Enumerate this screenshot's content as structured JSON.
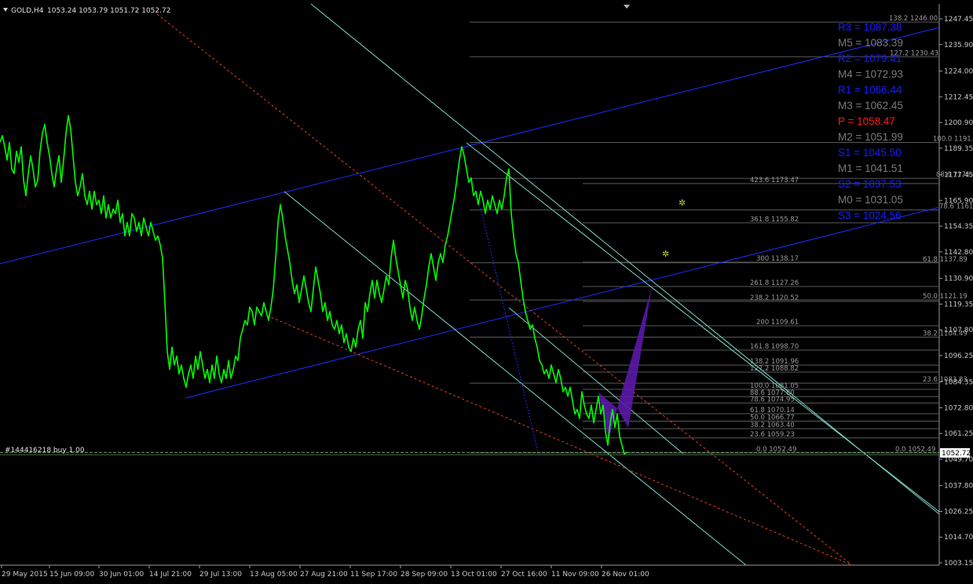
{
  "header": {
    "menu_icon": "triangle-down-icon",
    "symbol": "GOLD,H4",
    "ohlc": "1053.24 1053.79 1051.72 1052.72"
  },
  "colors": {
    "background": "#000000",
    "price": "#00ff00",
    "channel": "#1e2cff",
    "trendline": "#7fd6c8",
    "dashed": "#e0401e",
    "fib": "#5a5a5a",
    "pattern": "#5a1aa8",
    "pivot_r": "#1a1aff",
    "pivot_m": "#7a7a7a",
    "pivot_p": "#ff1a1a",
    "pivot_s": "#1a1aff",
    "current_price_bg": "#ffffff"
  },
  "pivots": [
    {
      "label": "R3 = 1087.38",
      "kind": "r"
    },
    {
      "label": "M5 = 1083.39",
      "kind": "m"
    },
    {
      "label": "R2 = 1079.41",
      "kind": "r"
    },
    {
      "label": "M4 = 1072.93",
      "kind": "m"
    },
    {
      "label": "R1 = 1066.44",
      "kind": "r"
    },
    {
      "label": "M3 = 1062.45",
      "kind": "m"
    },
    {
      "label": "P  = 1058.47",
      "kind": "p"
    },
    {
      "label": "M2 = 1051.99",
      "kind": "m"
    },
    {
      "label": "S1 = 1045.50",
      "kind": "s"
    },
    {
      "label": "M1 = 1041.51",
      "kind": "m"
    },
    {
      "label": "S2 = 1037.53",
      "kind": "s"
    },
    {
      "label": "M0 = 1031.05",
      "kind": "m"
    },
    {
      "label": "S3 = 1024.56",
      "kind": "s"
    }
  ],
  "order_label": "#144416218 buy 1.00",
  "current_price": "1052.72",
  "chart_data": {
    "type": "line",
    "symbol": "GOLD",
    "timeframe": "H4",
    "ylim": [
      1003.15,
      1247.45
    ],
    "y_ticks": [
      "1247.45",
      "1235.90",
      "1224.00",
      "1212.45",
      "1200.90",
      "1189.35",
      "1177.45",
      "1165.90",
      "1154.35",
      "1142.80",
      "1130.90",
      "1119.35",
      "1107.80",
      "1096.25",
      "1084.35",
      "1072.80",
      "1061.25",
      "1049.70",
      "1037.80",
      "1026.25",
      "1014.70",
      "1003.15"
    ],
    "x_ticks": [
      "29 May 2015",
      "15 Jun 09:00",
      "30 Jun 01:00",
      "14 Jul 21:00",
      "29 Jul 13:00",
      "13 Aug 05:00",
      "27 Aug 21:00",
      "11 Sep 17:00",
      "28 Sep 09:00",
      "13 Oct 01:00",
      "27 Oct 16:00",
      "11 Nov 09:00",
      "26 Nov 01:00"
    ],
    "series": [
      {
        "values": [
          [
            0,
            1192
          ],
          [
            3,
            1195
          ],
          [
            6,
            1190
          ],
          [
            9,
            1184
          ],
          [
            12,
            1192
          ],
          [
            15,
            1180
          ],
          [
            18,
            1178
          ],
          [
            21,
            1188
          ],
          [
            24,
            1183
          ],
          [
            27,
            1190
          ],
          [
            30,
            1175
          ],
          [
            33,
            1168
          ],
          [
            36,
            1178
          ],
          [
            39,
            1186
          ],
          [
            42,
            1180
          ],
          [
            45,
            1172
          ],
          [
            48,
            1175
          ],
          [
            51,
            1188
          ],
          [
            54,
            1196
          ],
          [
            57,
            1200
          ],
          [
            60,
            1192
          ],
          [
            63,
            1186
          ],
          [
            66,
            1178
          ],
          [
            69,
            1172
          ],
          [
            72,
            1180
          ],
          [
            75,
            1186
          ],
          [
            78,
            1174
          ],
          [
            81,
            1184
          ],
          [
            84,
            1196
          ],
          [
            87,
            1204
          ],
          [
            90,
            1198
          ],
          [
            93,
            1186
          ],
          [
            96,
            1174
          ],
          [
            99,
            1168
          ],
          [
            102,
            1172
          ],
          [
            105,
            1178
          ],
          [
            108,
            1168
          ],
          [
            111,
            1164
          ],
          [
            114,
            1170
          ],
          [
            117,
            1162
          ],
          [
            120,
            1170
          ],
          [
            123,
            1164
          ],
          [
            126,
            1166
          ],
          [
            129,
            1160
          ],
          [
            132,
            1168
          ],
          [
            135,
            1158
          ],
          [
            138,
            1164
          ],
          [
            141,
            1158
          ],
          [
            144,
            1162
          ],
          [
            147,
            1160
          ],
          [
            150,
            1166
          ],
          [
            153,
            1156
          ],
          [
            156,
            1160
          ],
          [
            159,
            1150
          ],
          [
            162,
            1156
          ],
          [
            165,
            1150
          ],
          [
            168,
            1160
          ],
          [
            171,
            1158
          ],
          [
            174,
            1152
          ],
          [
            177,
            1156
          ],
          [
            180,
            1150
          ],
          [
            183,
            1158
          ],
          [
            186,
            1154
          ],
          [
            189,
            1150
          ],
          [
            192,
            1156
          ],
          [
            195,
            1152
          ],
          [
            198,
            1148
          ],
          [
            201,
            1150
          ],
          [
            204,
            1146
          ],
          [
            207,
            1140
          ],
          [
            210,
            1120
          ],
          [
            213,
            1098
          ],
          [
            216,
            1090
          ],
          [
            219,
            1100
          ],
          [
            222,
            1092
          ],
          [
            225,
            1096
          ],
          [
            228,
            1088
          ],
          [
            231,
            1092
          ],
          [
            234,
            1086
          ],
          [
            237,
            1082
          ],
          [
            240,
            1088
          ],
          [
            243,
            1092
          ],
          [
            246,
            1086
          ],
          [
            249,
            1096
          ],
          [
            252,
            1090
          ],
          [
            255,
            1098
          ],
          [
            258,
            1092
          ],
          [
            261,
            1086
          ],
          [
            264,
            1090
          ],
          [
            267,
            1084
          ],
          [
            270,
            1092
          ],
          [
            273,
            1086
          ],
          [
            276,
            1096
          ],
          [
            279,
            1088
          ],
          [
            282,
            1084
          ],
          [
            285,
            1090
          ],
          [
            288,
            1086
          ],
          [
            291,
            1094
          ],
          [
            294,
            1086
          ],
          [
            297,
            1090
          ],
          [
            300,
            1096
          ],
          [
            303,
            1094
          ],
          [
            306,
            1104
          ],
          [
            309,
            1108
          ],
          [
            312,
            1112
          ],
          [
            315,
            1110
          ],
          [
            318,
            1118
          ],
          [
            321,
            1116
          ],
          [
            324,
            1110
          ],
          [
            327,
            1118
          ],
          [
            330,
            1116
          ],
          [
            333,
            1114
          ],
          [
            336,
            1120
          ],
          [
            339,
            1116
          ],
          [
            342,
            1112
          ],
          [
            345,
            1118
          ],
          [
            348,
            1126
          ],
          [
            351,
            1140
          ],
          [
            354,
            1156
          ],
          [
            357,
            1164
          ],
          [
            360,
            1158
          ],
          [
            363,
            1150
          ],
          [
            366,
            1144
          ],
          [
            369,
            1138
          ],
          [
            372,
            1130
          ],
          [
            375,
            1124
          ],
          [
            378,
            1128
          ],
          [
            381,
            1120
          ],
          [
            384,
            1126
          ],
          [
            387,
            1132
          ],
          [
            390,
            1126
          ],
          [
            393,
            1120
          ],
          [
            396,
            1116
          ],
          [
            399,
            1126
          ],
          [
            402,
            1136
          ],
          [
            405,
            1130
          ],
          [
            408,
            1124
          ],
          [
            411,
            1116
          ],
          [
            414,
            1120
          ],
          [
            417,
            1112
          ],
          [
            420,
            1116
          ],
          [
            423,
            1110
          ],
          [
            426,
            1108
          ],
          [
            429,
            1112
          ],
          [
            432,
            1106
          ],
          [
            435,
            1110
          ],
          [
            438,
            1102
          ],
          [
            441,
            1106
          ],
          [
            444,
            1100
          ],
          [
            447,
            1098
          ],
          [
            450,
            1104
          ],
          [
            453,
            1100
          ],
          [
            456,
            1108
          ],
          [
            459,
            1112
          ],
          [
            462,
            1104
          ],
          [
            465,
            1120
          ],
          [
            468,
            1116
          ],
          [
            471,
            1124
          ],
          [
            474,
            1130
          ],
          [
            477,
            1122
          ],
          [
            480,
            1130
          ],
          [
            483,
            1124
          ],
          [
            486,
            1120
          ],
          [
            489,
            1126
          ],
          [
            492,
            1132
          ],
          [
            495,
            1128
          ],
          [
            498,
            1140
          ],
          [
            501,
            1148
          ],
          [
            504,
            1140
          ],
          [
            507,
            1134
          ],
          [
            510,
            1128
          ],
          [
            513,
            1122
          ],
          [
            516,
            1130
          ],
          [
            519,
            1126
          ],
          [
            522,
            1118
          ],
          [
            525,
            1112
          ],
          [
            528,
            1118
          ],
          [
            531,
            1112
          ],
          [
            534,
            1108
          ],
          [
            537,
            1114
          ],
          [
            540,
            1122
          ],
          [
            543,
            1128
          ],
          [
            546,
            1136
          ],
          [
            549,
            1142
          ],
          [
            552,
            1136
          ],
          [
            555,
            1130
          ],
          [
            558,
            1138
          ],
          [
            561,
            1142
          ],
          [
            564,
            1138
          ],
          [
            567,
            1146
          ],
          [
            570,
            1150
          ],
          [
            573,
            1156
          ],
          [
            576,
            1162
          ],
          [
            579,
            1168
          ],
          [
            582,
            1176
          ],
          [
            585,
            1184
          ],
          [
            588,
            1190
          ],
          [
            591,
            1186
          ],
          [
            594,
            1180
          ],
          [
            597,
            1174
          ],
          [
            600,
            1176
          ],
          [
            603,
            1168
          ],
          [
            606,
            1170
          ],
          [
            609,
            1164
          ],
          [
            612,
            1170
          ],
          [
            615,
            1166
          ],
          [
            618,
            1160
          ],
          [
            621,
            1166
          ],
          [
            624,
            1162
          ],
          [
            627,
            1168
          ],
          [
            630,
            1164
          ],
          [
            633,
            1160
          ],
          [
            636,
            1166
          ],
          [
            639,
            1162
          ],
          [
            642,
            1168
          ],
          [
            645,
            1176
          ],
          [
            648,
            1180
          ],
          [
            651,
            1160
          ],
          [
            654,
            1150
          ],
          [
            657,
            1142
          ],
          [
            660,
            1138
          ],
          [
            663,
            1130
          ],
          [
            666,
            1122
          ],
          [
            669,
            1116
          ],
          [
            672,
            1112
          ],
          [
            675,
            1108
          ],
          [
            678,
            1110
          ],
          [
            681,
            1104
          ],
          [
            684,
            1100
          ],
          [
            687,
            1094
          ],
          [
            690,
            1092
          ],
          [
            693,
            1088
          ],
          [
            696,
            1090
          ],
          [
            699,
            1086
          ],
          [
            702,
            1092
          ],
          [
            705,
            1088
          ],
          [
            708,
            1084
          ],
          [
            711,
            1090
          ],
          [
            714,
            1086
          ],
          [
            717,
            1080
          ],
          [
            720,
            1082
          ],
          [
            723,
            1078
          ],
          [
            726,
            1082
          ],
          [
            729,
            1076
          ],
          [
            732,
            1070
          ],
          [
            735,
            1072
          ],
          [
            738,
            1068
          ],
          [
            741,
            1080
          ],
          [
            744,
            1074
          ],
          [
            747,
            1070
          ],
          [
            750,
            1068
          ],
          [
            753,
            1074
          ],
          [
            756,
            1066
          ],
          [
            759,
            1072
          ],
          [
            762,
            1078
          ],
          [
            765,
            1070
          ],
          [
            768,
            1074
          ],
          [
            771,
            1062
          ],
          [
            774,
            1056
          ],
          [
            777,
            1066
          ],
          [
            780,
            1072
          ],
          [
            783,
            1064
          ],
          [
            786,
            1070
          ],
          [
            789,
            1060
          ],
          [
            792,
            1056
          ],
          [
            795,
            1052
          ],
          [
            798,
            1052.72
          ]
        ]
      }
    ],
    "fib_levels": [
      {
        "ratio": "138.2",
        "price": "1246.00"
      },
      {
        "ratio": "127.2",
        "price": "1230.43"
      },
      {
        "ratio": "100.0",
        "price": "1191.94"
      },
      {
        "ratio": "88.6",
        "price": "1175.81"
      },
      {
        "ratio": "423.6",
        "price": "1173.47"
      },
      {
        "ratio": "78.6",
        "price": "1161.66"
      },
      {
        "ratio": "361.8",
        "price": "1155.82"
      },
      {
        "ratio": "300",
        "price": "1138.17"
      },
      {
        "ratio": "61.8",
        "price": "1137.89"
      },
      {
        "ratio": "261.8",
        "price": "1127.26"
      },
      {
        "ratio": "238.2",
        "price": "1120.52"
      },
      {
        "ratio": "50.0",
        "price": "1121.19"
      },
      {
        "ratio": "200",
        "price": "1109.61"
      },
      {
        "ratio": "38.2",
        "price": "1104.49"
      },
      {
        "ratio": "161.8",
        "price": "1098.70"
      },
      {
        "ratio": "138.2",
        "price": "1091.96"
      },
      {
        "ratio": "127.2",
        "price": "1088.82"
      },
      {
        "ratio": "23.6",
        "price": "1083.83"
      },
      {
        "ratio": "100.0",
        "price": "1081.05"
      },
      {
        "ratio": "88.6",
        "price": "1077.80"
      },
      {
        "ratio": "78.6",
        "price": "1074.95"
      },
      {
        "ratio": "61.8",
        "price": "1070.14"
      },
      {
        "ratio": "50.0",
        "price": "1066.77"
      },
      {
        "ratio": "38.2",
        "price": "1063.40"
      },
      {
        "ratio": "23.6",
        "price": "1059.23"
      },
      {
        "ratio": "0.0",
        "price": "1052.49"
      },
      {
        "ratio": "0.0",
        "price": "1052.49"
      }
    ]
  }
}
